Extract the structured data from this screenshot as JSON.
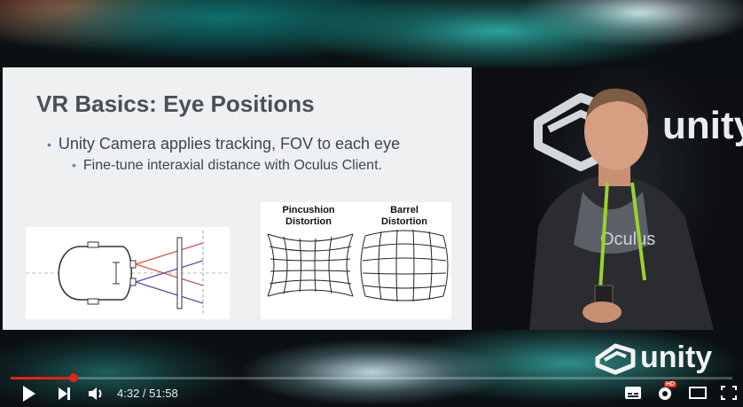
{
  "slide": {
    "title": "VR Basics: Eye Positions",
    "bullet1": "Unity Camera applies tracking, FOV to each eye",
    "bullet2": "Fine-tune interaxial distance with Oculus Client.",
    "pincushion_label_1": "Pincushion",
    "pincushion_label_2": "Distortion",
    "barrel_label_1": "Barrel",
    "barrel_label_2": "Distortion"
  },
  "backdrop": {
    "brand_text": "unity",
    "shirt_text": "Oculus"
  },
  "watermark": {
    "text": "unity"
  },
  "player": {
    "time_display": "4:32 / 51:58",
    "hd_badge": "HD",
    "progress_fraction": 0.087,
    "accent_color": "#e62117",
    "icons": [
      "play-icon",
      "next-icon",
      "volume-icon",
      "subtitles-icon",
      "settings-icon",
      "theater-icon",
      "fullscreen-icon"
    ]
  }
}
